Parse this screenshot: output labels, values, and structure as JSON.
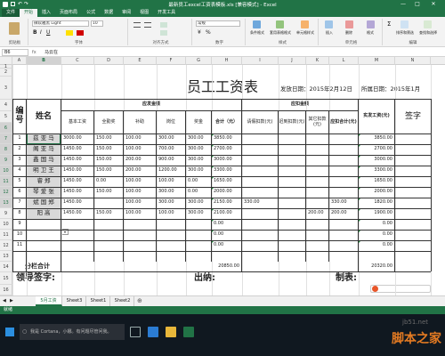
{
  "window": {
    "title": "最新员工excel工资表模板.xls  [兼容模式] - Excel",
    "minimize": "—",
    "maximize": "□",
    "close": "✕"
  },
  "menu": [
    "文件",
    "开始",
    "插入",
    "页面布局",
    "公式",
    "数据",
    "审阅",
    "视图",
    "开发工具"
  ],
  "ribbon": {
    "font_name": "微软雅黑 Light",
    "font_size": "10",
    "number_format": "常规",
    "groups": [
      "剪贴板",
      "字体",
      "对齐方式",
      "数字",
      "样式",
      "单元格",
      "编辑"
    ],
    "buttons": [
      "条件格式",
      "套用表格格式",
      "单元格样式",
      "插入",
      "删除",
      "格式",
      "排序和筛选",
      "查找和选择"
    ]
  },
  "formula_bar": {
    "name_box": "B6",
    "fx": "fx",
    "content": "马云在"
  },
  "columns": [
    "A",
    "B",
    "C",
    "D",
    "E",
    "F",
    "G",
    "H",
    "I",
    "J",
    "K",
    "L",
    "M",
    "N"
  ],
  "sheet": {
    "title": "员工工资表",
    "issue_date": "发放日期：2015年2月12日",
    "period": "所属日期：2015年1月",
    "headers": {
      "no": "编号",
      "name": "姓名",
      "payable": "应发金额",
      "base": "基本工资",
      "attendance": "全勤奖",
      "subsidy": "补助",
      "post": "岗位",
      "bonus": "奖金",
      "total": "合计（元）",
      "deduction": "应扣金额",
      "leave": "请假扣款(元)",
      "late": "迟到扣款(元)",
      "other": "其它扣款(元)",
      "deduct_total": "应扣合计(元)",
      "actual": "实发工资(元)",
      "sign": "签字"
    },
    "rows": [
      {
        "no": "1",
        "name": "茲 亚 马",
        "base": "3000.00",
        "att": "150.00",
        "sub": "100.00",
        "post": "300.00",
        "bonus": "300.00",
        "total": "3850.00",
        "leave": "",
        "late": "",
        "other": "",
        "dtotal": "",
        "actual": "3850.00"
      },
      {
        "no": "2",
        "name": "阁 亚 马",
        "base": "1450.00",
        "att": "150.00",
        "sub": "100.00",
        "post": "700.00",
        "bonus": "300.00",
        "total": "2700.00",
        "leave": "",
        "late": "",
        "other": "",
        "dtotal": "",
        "actual": "2700.00"
      },
      {
        "no": "3",
        "name": "鑫 国 马",
        "base": "1450.00",
        "att": "150.00",
        "sub": "200.00",
        "post": "900.00",
        "bonus": "300.00",
        "total": "3000.00",
        "leave": "",
        "late": "",
        "other": "",
        "dtotal": "",
        "actual": "3000.00"
      },
      {
        "no": "4",
        "name": "明 卫 王",
        "base": "1450.00",
        "att": "150.00",
        "sub": "200.00",
        "post": "1200.00",
        "bonus": "300.00",
        "total": "3300.00",
        "leave": "",
        "late": "",
        "other": "",
        "dtotal": "",
        "actual": "3300.00"
      },
      {
        "no": "5",
        "name": "睿 郑",
        "base": "1450.00",
        "att": "0.00",
        "sub": "100.00",
        "post": "100.00",
        "bonus": "0.00",
        "total": "1650.00",
        "leave": "",
        "late": "",
        "other": "",
        "dtotal": "",
        "actual": "1650.00"
      },
      {
        "no": "6",
        "name": "琴 爱 张",
        "base": "1450.00",
        "att": "150.00",
        "sub": "100.00",
        "post": "300.00",
        "bonus": "0.00",
        "total": "2000.00",
        "leave": "",
        "late": "",
        "other": "",
        "dtotal": "",
        "actual": "2000.00"
      },
      {
        "no": "7",
        "name": "斌 国 郑",
        "base": "1450.00",
        "att": "",
        "sub": "100.00",
        "post": "300.00",
        "bonus": "300.00",
        "total": "2150.00",
        "leave": "330.00",
        "late": "",
        "other": "",
        "dtotal": "330.00",
        "actual": "1820.00"
      },
      {
        "no": "8",
        "name": "阳 高",
        "base": "1450.00",
        "att": "150.00",
        "sub": "100.00",
        "post": "100.00",
        "bonus": "300.00",
        "total": "2100.00",
        "leave": "",
        "late": "",
        "other": "200.00",
        "dtotal": "200.00",
        "actual": "1900.00"
      },
      {
        "no": "9",
        "name": "",
        "base": "",
        "att": "",
        "sub": "",
        "post": "",
        "bonus": "",
        "total": "0.00",
        "leave": "",
        "late": "",
        "other": "",
        "dtotal": "",
        "actual": "0.00"
      },
      {
        "no": "10",
        "name": "",
        "base": "",
        "att": "",
        "sub": "",
        "post": "",
        "bonus": "",
        "total": "0.00",
        "leave": "",
        "late": "",
        "other": "",
        "dtotal": "",
        "actual": "0.00"
      },
      {
        "no": "11",
        "name": "",
        "base": "",
        "att": "",
        "sub": "",
        "post": "",
        "bonus": "",
        "total": "0.00",
        "leave": "",
        "late": "",
        "other": "",
        "dtotal": "",
        "actual": "0.00"
      }
    ],
    "subtotal_label": "分栏合计",
    "subtotal_total": "20850.00",
    "subtotal_actual": "20320.00",
    "leader_sign": "领导签字:",
    "cashier": "出纳:",
    "preparer": "制表:"
  },
  "row_numbers": [
    "1",
    "2",
    "3",
    "4",
    "5",
    "6",
    "7",
    "8",
    "9",
    "10",
    "11",
    "12",
    "13",
    "9",
    "10",
    "11",
    "12",
    "13",
    "14",
    "15",
    "16",
    "17",
    "18",
    "19"
  ],
  "sheets": [
    "5月工资",
    "Sheet3",
    "Sheet1",
    "Sheet2"
  ],
  "status": "就绪",
  "taskbar": {
    "search_placeholder": "我是 Cortana，小娜。有问题尽管问我。"
  },
  "watermark": {
    "site": "jb51.net",
    "brand": "脚本之家"
  },
  "colors": {
    "excel_green": "#217346",
    "selected_fill": "#d9d9d9"
  }
}
